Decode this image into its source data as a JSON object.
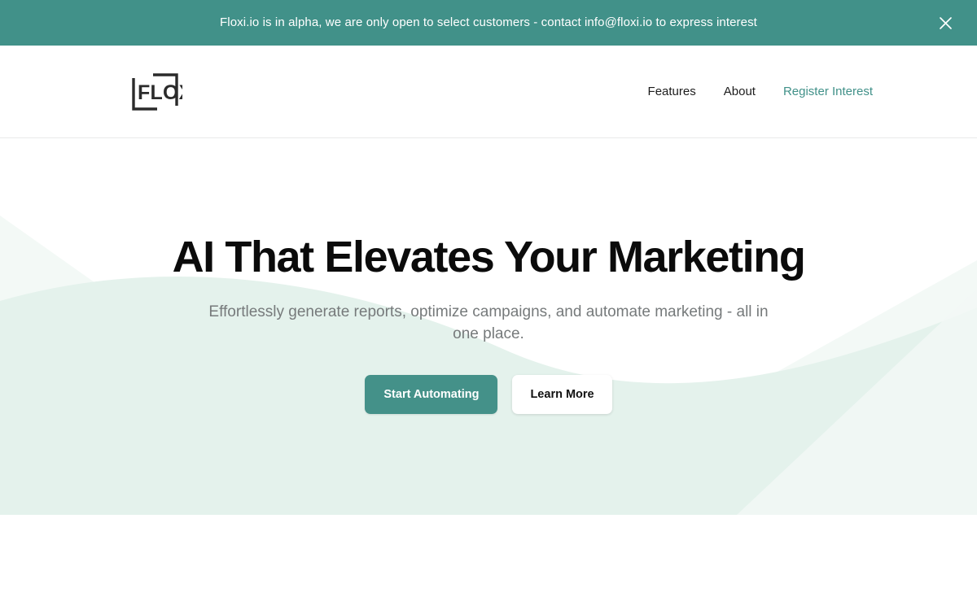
{
  "banner": {
    "message": "Floxi.io is in alpha, we are only open to select customers - contact info@floxi.io to express interest",
    "close_label": "close-icon",
    "background_color": "#419189",
    "text_color": "#ffffff"
  },
  "header": {
    "logo_text": "FLOXI",
    "nav": [
      {
        "label": "Features",
        "accent": false
      },
      {
        "label": "About",
        "accent": false
      },
      {
        "label": "Register Interest",
        "accent": true
      }
    ]
  },
  "hero": {
    "title": "AI That Elevates Your Marketing",
    "subtitle": "Effortlessly generate reports, optimize campaigns, and automate marketing - all in one place.",
    "primary_cta": "Start Automating",
    "secondary_cta": "Learn More",
    "background_color": "#e4f2ec"
  },
  "colors": {
    "accent_teal": "#419189",
    "button_teal": "#449189",
    "hero_mint": "#e4f2ec",
    "title_black": "#0b0b0b",
    "subtitle_gray": "#767a7b",
    "header_border": "#e9eaea"
  }
}
